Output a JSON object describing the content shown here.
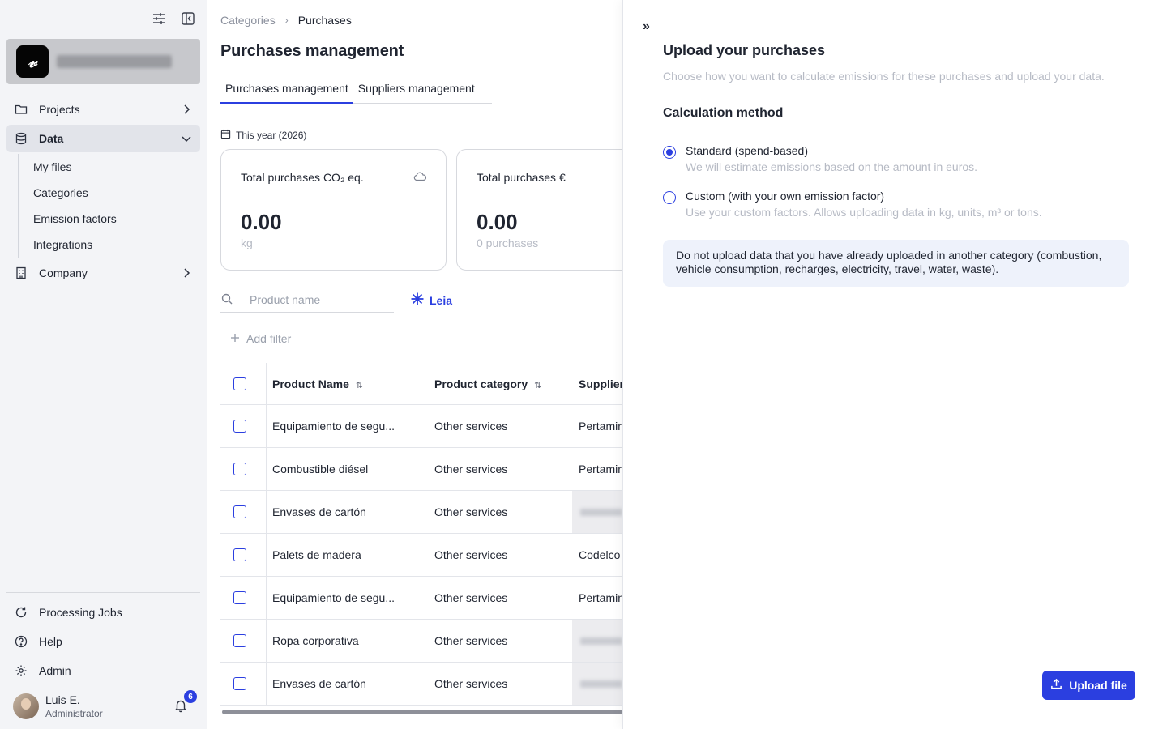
{
  "sidebar": {
    "org_logo": "𝓋",
    "nav": [
      {
        "label": "Projects",
        "icon": "folder-icon"
      },
      {
        "label": "Data",
        "icon": "database-icon"
      },
      {
        "label": "Company",
        "icon": "building-icon"
      }
    ],
    "data_sub": [
      "My files",
      "Categories",
      "Emission factors",
      "Integrations"
    ],
    "bottom": [
      {
        "label": "Processing Jobs",
        "icon": "refresh-icon"
      },
      {
        "label": "Help",
        "icon": "help-circle-icon"
      },
      {
        "label": "Admin",
        "icon": "gear-icon"
      }
    ],
    "user": {
      "name": "Luis E.",
      "role": "Administrator",
      "notifications": "6"
    }
  },
  "main": {
    "breadcrumb": [
      "Categories",
      "Purchases"
    ],
    "breadcrumb_sep": "›",
    "title": "Purchases management",
    "tabs": [
      "Purchases management",
      "Suppliers management"
    ],
    "period": "This year (2026)",
    "cards": [
      {
        "title": "Total purchases CO₂ eq.",
        "value": "0.00",
        "unit": "kg"
      },
      {
        "title": "Total purchases €",
        "value": "0.00",
        "unit": "0 purchases"
      }
    ],
    "search_placeholder": "Product name",
    "leia_label": "Leia",
    "add_filter": "Add filter",
    "sort_glyph": "⇅",
    "columns": [
      "Product Name",
      "Product category",
      "Supplier"
    ],
    "rows": [
      {
        "name": "Equipamiento de segu...",
        "category": "Other services",
        "supplier": "Pertamina"
      },
      {
        "name": "Combustible diésel",
        "category": "Other services",
        "supplier": "Pertamina"
      },
      {
        "name": "Envases de cartón",
        "category": "Other services",
        "supplier": ""
      },
      {
        "name": "Palets de madera",
        "category": "Other services",
        "supplier": "Codelco"
      },
      {
        "name": "Equipamiento de segu...",
        "category": "Other services",
        "supplier": "Pertamina"
      },
      {
        "name": "Ropa corporativa",
        "category": "Other services",
        "supplier": ""
      },
      {
        "name": "Envases de cartón",
        "category": "Other services",
        "supplier": ""
      }
    ]
  },
  "panel": {
    "collapse_glyph": "»",
    "title": "Upload your purchases",
    "subtitle": "Choose how you want to calculate emissions for these purchases and upload your data.",
    "method_heading": "Calculation method",
    "options": [
      {
        "label": "Standard (spend-based)",
        "description": "We will estimate emissions based on the amount in euros.",
        "selected": true
      },
      {
        "label": "Custom (with your own emission factor)",
        "description": "Use your custom factors. Allows uploading data in kg, units, m³ or tons.",
        "selected": false
      }
    ],
    "notice": "Do not upload data that you have already uploaded in another category (combustion, vehicle consumption, recharges, electricity, travel, water, waste).",
    "upload_label": "Upload file"
  },
  "colors": {
    "accent": "#2b3fe0",
    "sidebar_bg": "#f3f4f7",
    "notice_bg": "#eef2fb"
  }
}
